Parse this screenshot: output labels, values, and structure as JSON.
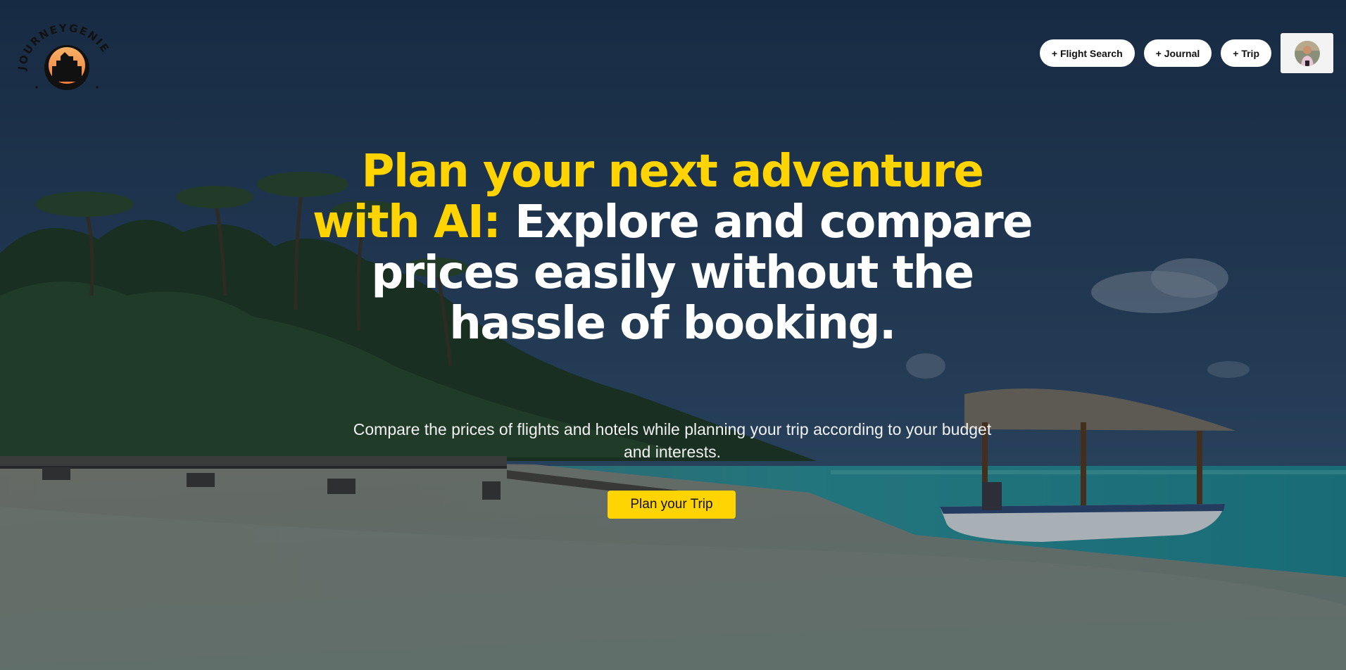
{
  "brand": {
    "name": "JOURNEYGENIE"
  },
  "nav": {
    "flight_search": "+ Flight Search",
    "journal": "+ Journal",
    "trip": "+ Trip"
  },
  "hero": {
    "title_highlight": "Plan your next adventure with AI:",
    "title_rest": "Explore and compare prices easily without the hassle of booking.",
    "subtitle": "Compare the prices of flights and hotels while planning your trip according to your budget and interests.",
    "cta_label": "Plan your Trip"
  },
  "colors": {
    "accent": "#ffd400",
    "heading": "#ffffff",
    "pill_bg": "#ffffff"
  },
  "icons": {
    "logo": "palace-sunset-emblem",
    "avatar": "user-avatar"
  }
}
